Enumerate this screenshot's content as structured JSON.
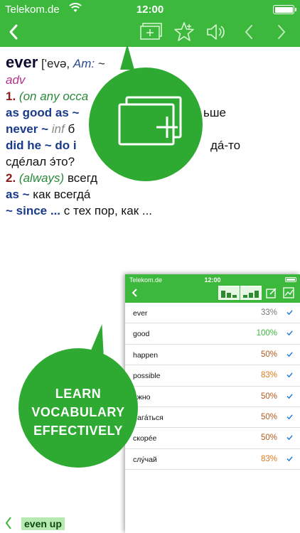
{
  "status": {
    "carrier": "Telekom.de",
    "time": "12:00"
  },
  "navbar": {
    "icons": [
      "back-chevron-icon",
      "add-card-icon",
      "favorite-star-icon",
      "speaker-icon",
      "previous-icon",
      "next-icon"
    ]
  },
  "entry": {
    "headword": "ever",
    "transcription": "['evə,",
    "am_label": "Am:",
    "am_trail": "~",
    "pos": "adv",
    "sense1_num": "1.",
    "sense1_gloss": "(on any occa",
    "phrase1": "as good as ~",
    "phrase1_ru": "ьше",
    "phrase2": "never ~",
    "phrase2_label": "inf",
    "phrase2_ru": "б",
    "phrase3": "did he ~ do i",
    "phrase3_ru": "дá-то",
    "line5_ru": "сдéлал э́то?",
    "sense2_num": "2.",
    "sense2_gloss": "(always)",
    "sense2_ru": "всегд",
    "phrase4": "as ~",
    "phrase4_ru": "как всегдá",
    "phrase5": "~ since ...",
    "phrase5_ru": "с тех пор, как ..."
  },
  "promo": {
    "learn_line1": "LEARN",
    "learn_line2": "VOCABULARY",
    "learn_line3": "EFFECTIVELY"
  },
  "inset": {
    "carrier": "Telekom.de",
    "time": "12:00",
    "rows": [
      {
        "word": "ever",
        "percent": "33%",
        "color": "#777777"
      },
      {
        "word": "good",
        "percent": "100%",
        "color": "#3cb83c"
      },
      {
        "word": "happen",
        "percent": "50%",
        "color": "#b35a1f"
      },
      {
        "word": "possible",
        "percent": "83%",
        "color": "#e07b1a"
      },
      {
        "word": "óжно",
        "percent": "50%",
        "color": "#b35a1f"
      },
      {
        "word": "лагáться",
        "percent": "50%",
        "color": "#b35a1f"
      },
      {
        "word": "скорée",
        "percent": "50%",
        "color": "#b35a1f"
      },
      {
        "word": "слу́чай",
        "percent": "83%",
        "color": "#e07b1a"
      }
    ]
  },
  "bottom": {
    "next_entry": "even up"
  },
  "colors": {
    "brand_green": "#3cb83c",
    "bubble_green": "#2eaa32",
    "check_blue": "#1a7ad9"
  }
}
